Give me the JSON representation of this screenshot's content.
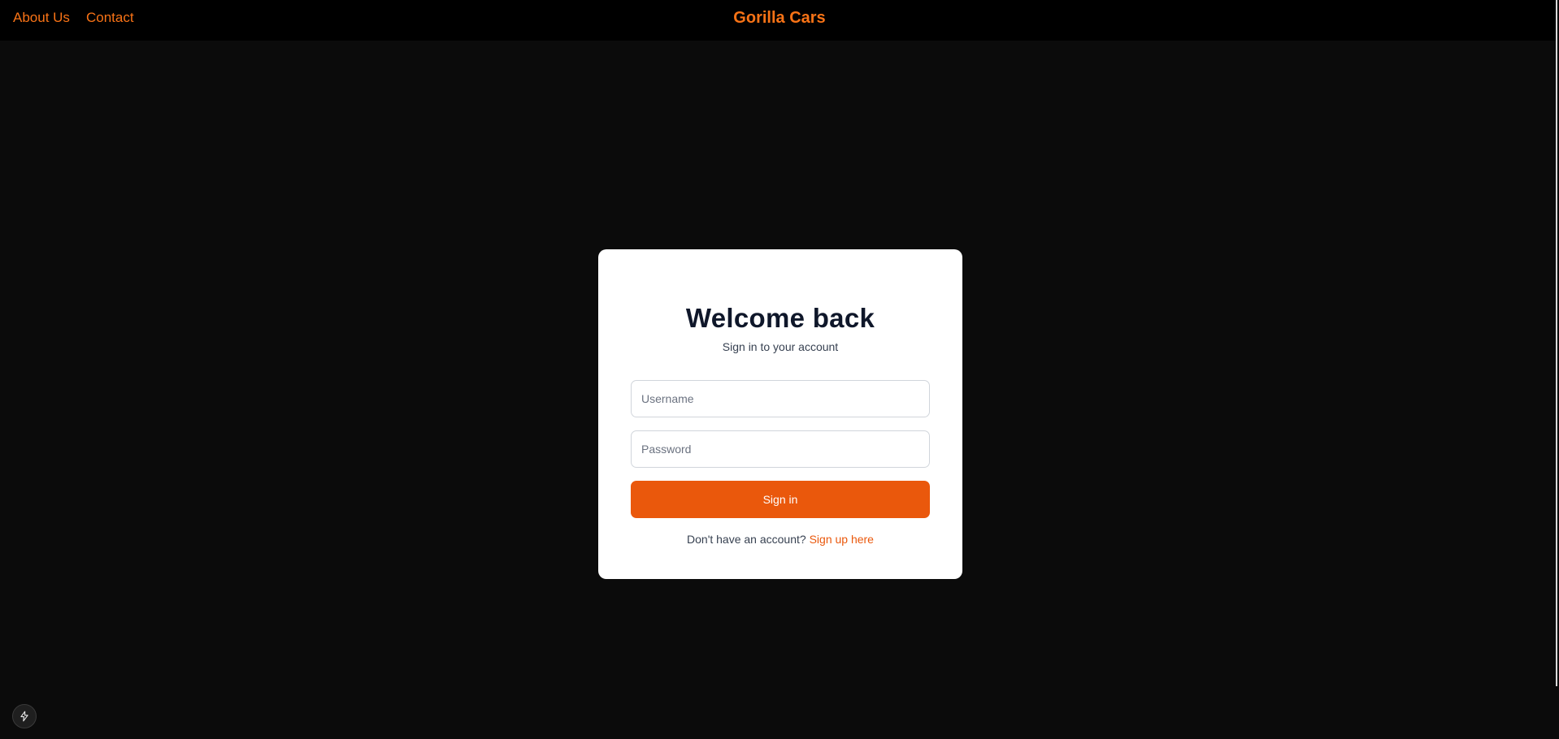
{
  "nav": {
    "about_label": "About Us",
    "contact_label": "Contact",
    "brand": "Gorilla Cars"
  },
  "login": {
    "title": "Welcome back",
    "subtitle": "Sign in to your account",
    "username_placeholder": "Username",
    "username_value": "",
    "password_placeholder": "Password",
    "password_value": "",
    "submit_label": "Sign in",
    "signup_prompt": "Don't have an account?",
    "signup_link": "Sign up here"
  },
  "floating": {
    "icon": "lightning-bolt-icon"
  },
  "colors": {
    "accent": "#ea580c",
    "brand_text": "#f97316",
    "background": "#0b0b0b",
    "topbar": "#000000",
    "card": "#ffffff",
    "title_text": "#0f172a"
  }
}
